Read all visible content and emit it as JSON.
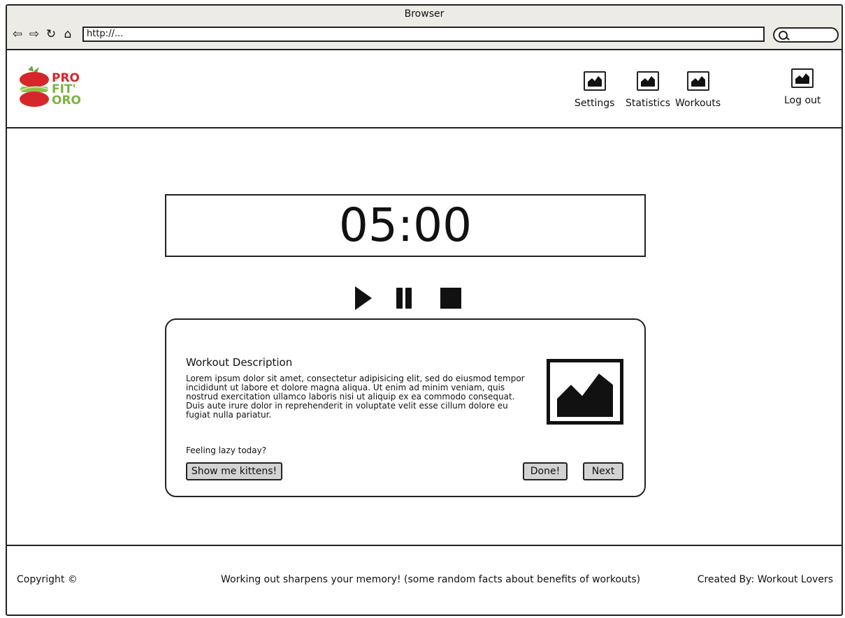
{
  "browser": {
    "title": "Browser",
    "url": "http://...",
    "nav_icons": [
      "back-arrow-icon",
      "forward-arrow-icon",
      "reload-icon",
      "home-icon"
    ]
  },
  "header": {
    "logo": {
      "line1": "PRO",
      "line2": "FIT'",
      "line3": "ORO"
    },
    "nav": [
      {
        "label": "Settings",
        "icon": "image-icon"
      },
      {
        "label": "Statistics",
        "icon": "image-icon"
      },
      {
        "label": "Workouts",
        "icon": "image-icon"
      }
    ],
    "logout": {
      "label": "Log out",
      "icon": "image-icon"
    }
  },
  "timer": {
    "value": "05:00"
  },
  "controls": [
    "play-icon",
    "pause-icon",
    "stop-icon"
  ],
  "workout": {
    "title": "Workout Description",
    "description": "Lorem ipsum dolor sit amet, consectetur adipisicing elit, sed do eiusmod tempor incididunt ut labore et dolore magna aliqua. Ut enim ad minim veniam, quis nostrud exercitation ullamco laboris nisi ut aliquip ex ea commodo consequat. Duis aute irure dolor in reprehenderit in voluptate velit esse cillum dolore eu fugiat nulla pariatur.",
    "lazy_prompt": "Feeling lazy today?",
    "kittens_button": "Show me kittens!",
    "done_button": "Done!",
    "next_button": "Next"
  },
  "footer": {
    "copyright": "Copyright ©",
    "fact": "Working out sharpens your memory! (some random facts about benefits of workouts)",
    "credits": "Created By: Workout Lovers"
  }
}
